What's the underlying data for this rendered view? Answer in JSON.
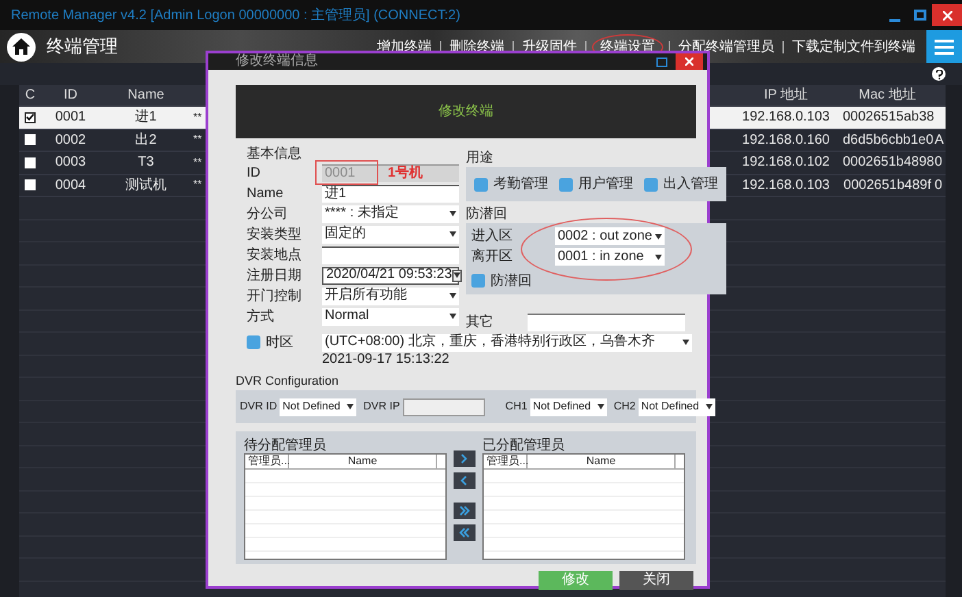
{
  "window": {
    "title": "Remote Manager v4.2 [Admin Logon 00000000 : 主管理员] (CONNECT:2)"
  },
  "header": {
    "title": "终端管理",
    "nav": [
      {
        "label": "增加终端",
        "annotated": false
      },
      {
        "label": "删除终端",
        "annotated": false
      },
      {
        "label": "升级固件",
        "annotated": false
      },
      {
        "label": "终端设置",
        "annotated": true
      },
      {
        "label": "分配终端管理员",
        "annotated": false
      },
      {
        "label": "下载定制文件到终端",
        "annotated": false
      }
    ]
  },
  "table": {
    "columns": [
      "C",
      "ID",
      "Name",
      "IP 地址",
      "Mac 地址"
    ],
    "rows": [
      {
        "checked": true,
        "selected": true,
        "id": "0001",
        "name": "进1",
        "column_4": "**",
        "ip": "192.168.0.103",
        "mac": "00026515ab38"
      },
      {
        "checked": false,
        "selected": false,
        "id": "0002",
        "name": "出2",
        "column_4": "**",
        "ip": "192.168.0.160",
        "mac": "d6d5b6cbb1e0",
        "column_7": "A"
      },
      {
        "checked": false,
        "selected": false,
        "id": "0003",
        "name": "T3",
        "column_4": "**",
        "ip": "192.168.0.102",
        "mac": "0002651b4898",
        "column_7": "0"
      },
      {
        "checked": false,
        "selected": false,
        "id": "0004",
        "name": "测试机",
        "column_4": "**",
        "ip": "192.168.0.103",
        "mac": "0002651b489f",
        "column_7": "0"
      }
    ]
  },
  "dialog": {
    "title": "修改终端信息",
    "banner": "修改终端",
    "basic": {
      "heading": "基本信息",
      "fields": [
        {
          "kind": "text",
          "label": "ID",
          "value": "0001",
          "disabled": true,
          "note": "1号机"
        },
        {
          "kind": "text",
          "label": "Name",
          "value": "进1",
          "disabled": false
        },
        {
          "kind": "select",
          "label": "分公司",
          "value": "**** : 未指定"
        },
        {
          "kind": "select",
          "label": "安装类型",
          "value": "固定的"
        },
        {
          "kind": "text",
          "label": "安装地点",
          "disabled": false
        },
        {
          "kind": "date",
          "label": "注册日期",
          "value": "2020/04/21 09:53:23"
        },
        {
          "kind": "select",
          "label": "开门控制",
          "value": "开启所有功能"
        },
        {
          "kind": "select",
          "label": "方式",
          "value": "Normal"
        }
      ]
    },
    "usage": {
      "heading": "用途",
      "options": [
        {
          "label": "考勤管理",
          "checked": true
        },
        {
          "label": "用户管理",
          "checked": true
        },
        {
          "label": "出入管理",
          "checked": true
        }
      ]
    },
    "anti_passback": {
      "heading": "防潜回",
      "entry_label": "进入区",
      "entry": "0002 : out zone",
      "exit_label": "离开区",
      "exit": "0001 : in zone",
      "checkbox": {
        "label": "防潜回",
        "checked": true
      }
    },
    "other": {
      "label": "其它"
    },
    "timezone": {
      "label": "时区",
      "checked": true,
      "value": "(UTC+08:00) 北京，重庆，香港特别行政区，乌鲁木齐",
      "time": "2021-09-17 15:13:22"
    },
    "dvr": {
      "heading": "DVR Configuration",
      "fields": [
        {
          "kind": "select",
          "label": "DVR ID",
          "value": "Not Defined"
        },
        {
          "kind": "text",
          "label": "DVR IP"
        },
        {
          "kind": "select",
          "label": "CH1",
          "value": "Not Defined"
        },
        {
          "kind": "select",
          "label": "CH2",
          "value": "Not Defined"
        }
      ]
    },
    "unassigned": {
      "heading": "待分配管理员",
      "columns": [
        "管理员...",
        "Name"
      ]
    },
    "assigned": {
      "heading": "已分配管理员",
      "columns": [
        "管理员...",
        "Name"
      ]
    },
    "buttons": [
      {
        "label": "修改",
        "kind": "primary"
      },
      {
        "label": "关闭",
        "kind": "secondary"
      }
    ]
  }
}
